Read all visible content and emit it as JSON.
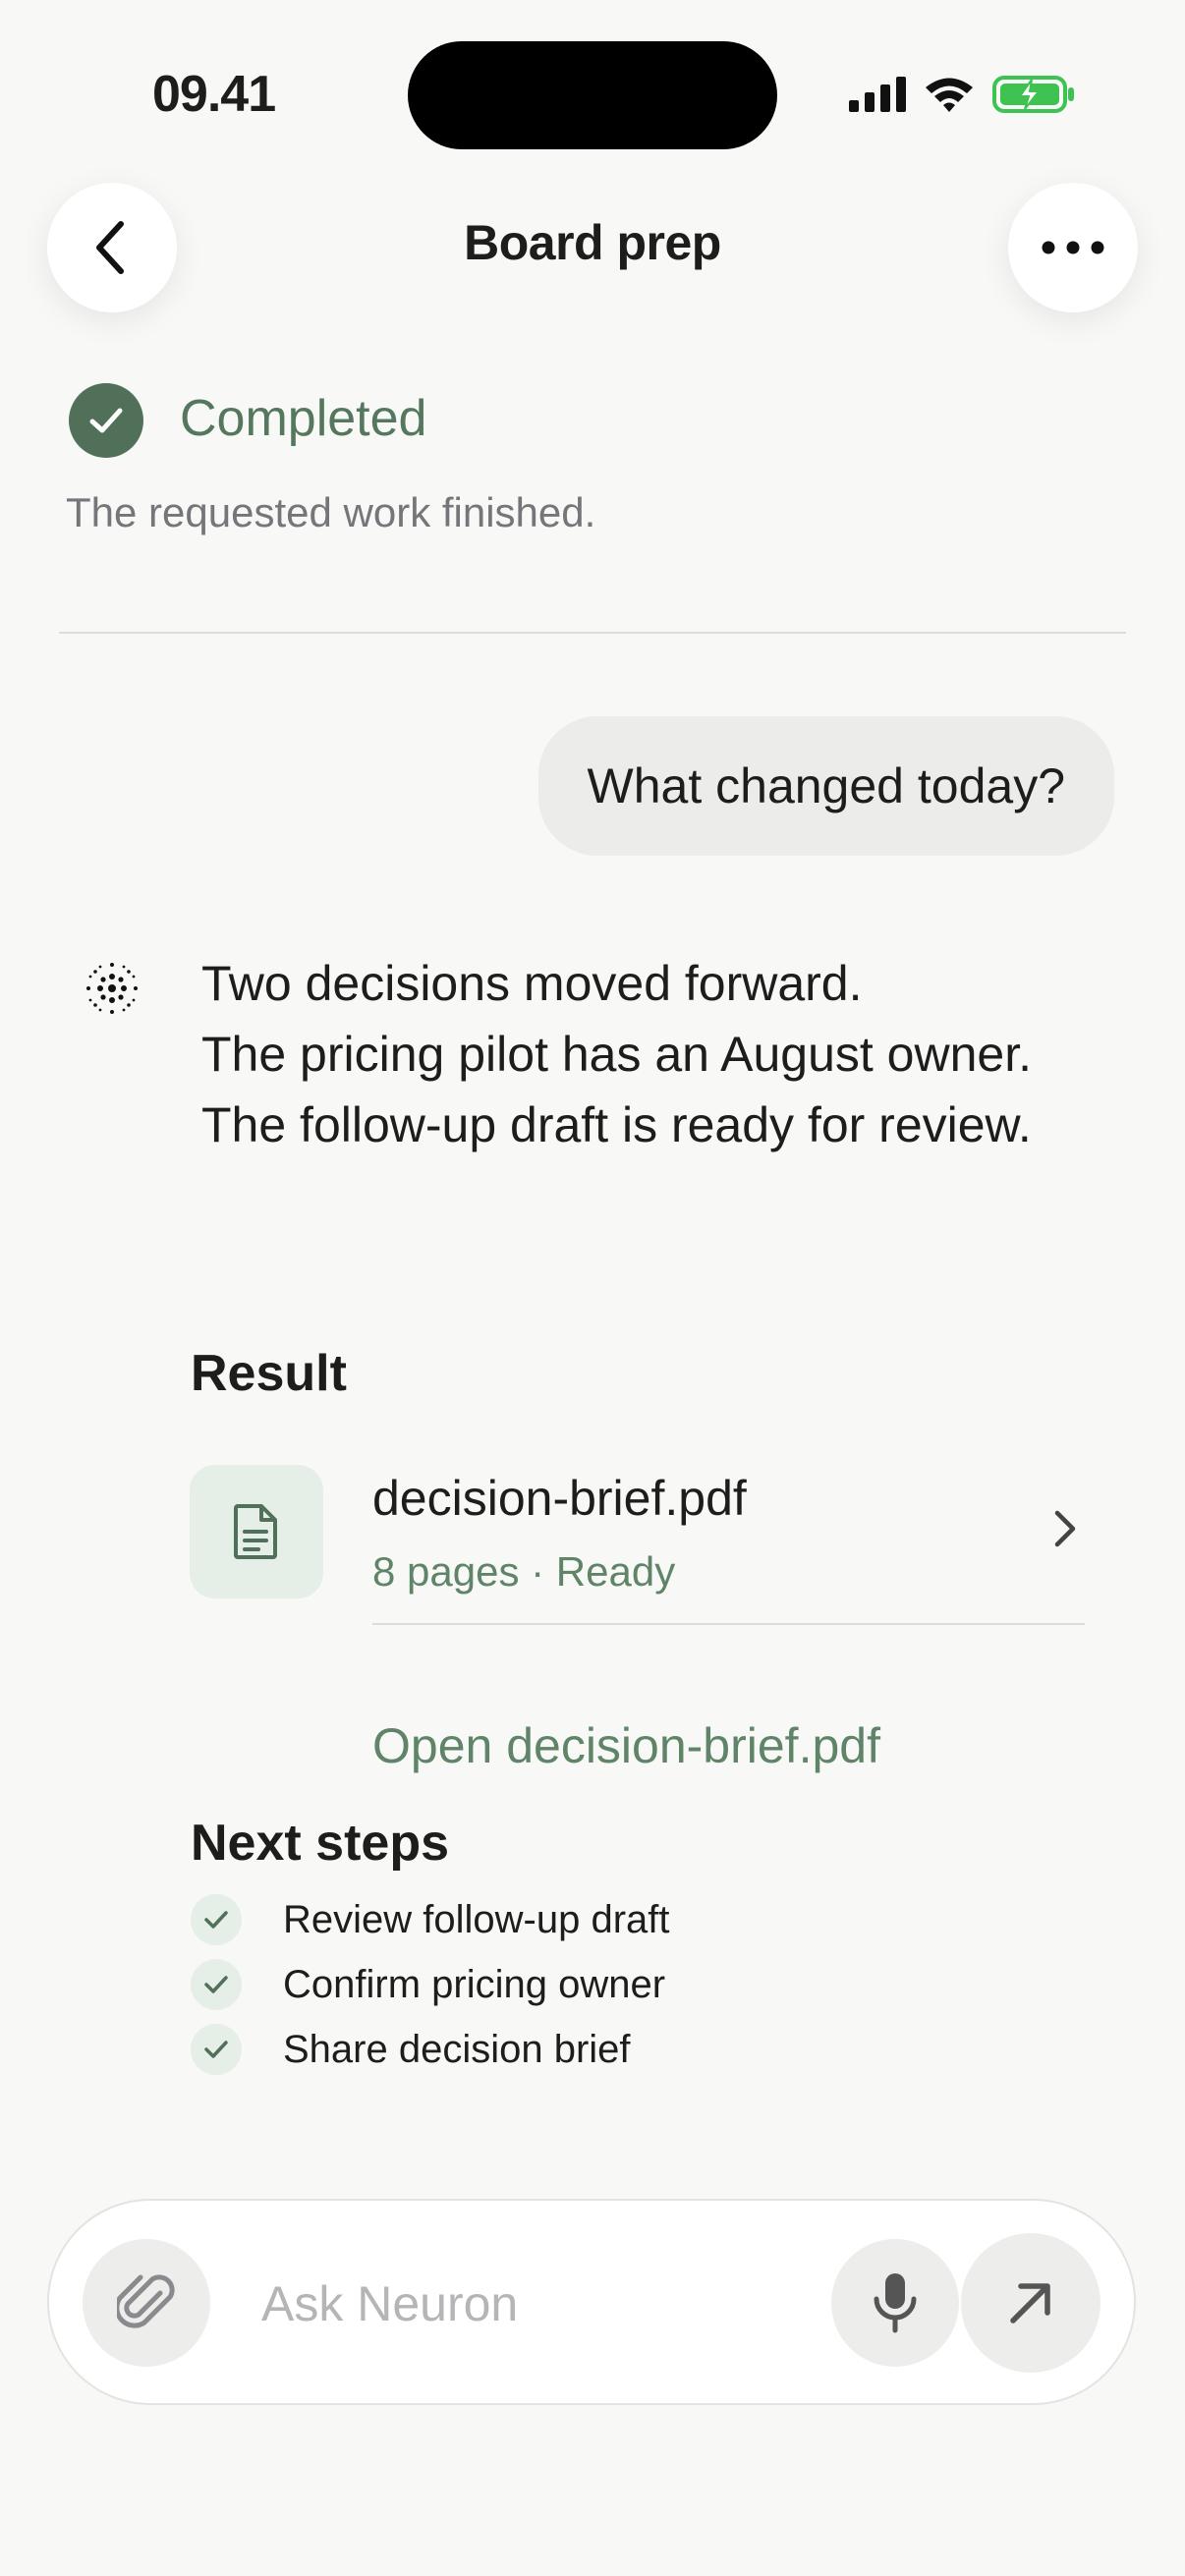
{
  "status_bar": {
    "time": "09.41",
    "icons": [
      "signal-icon",
      "wifi-icon",
      "battery-charging-icon"
    ],
    "battery_color": "#3ec251"
  },
  "header": {
    "title": "Board prep",
    "back_icon": "chevron-left-icon",
    "more_icon": "more-horizontal-icon"
  },
  "status": {
    "label": "Completed",
    "description": "The requested work finished.",
    "accent_color": "#54775d"
  },
  "conversation": {
    "user_message": "What changed today?",
    "assistant_lines": [
      "Two decisions moved forward.",
      "The pricing pilot has an August owner.",
      "The follow-up draft is ready for review."
    ]
  },
  "result": {
    "heading": "Result",
    "file": {
      "name": "decision-brief.pdf",
      "meta": "8 pages · Ready",
      "icon": "document-icon"
    },
    "open_link": "Open decision-brief.pdf"
  },
  "next_steps": {
    "heading": "Next steps",
    "items": [
      "Review follow-up draft",
      "Confirm pricing owner",
      "Share decision brief"
    ]
  },
  "composer": {
    "placeholder": "Ask Neuron",
    "value": ""
  }
}
